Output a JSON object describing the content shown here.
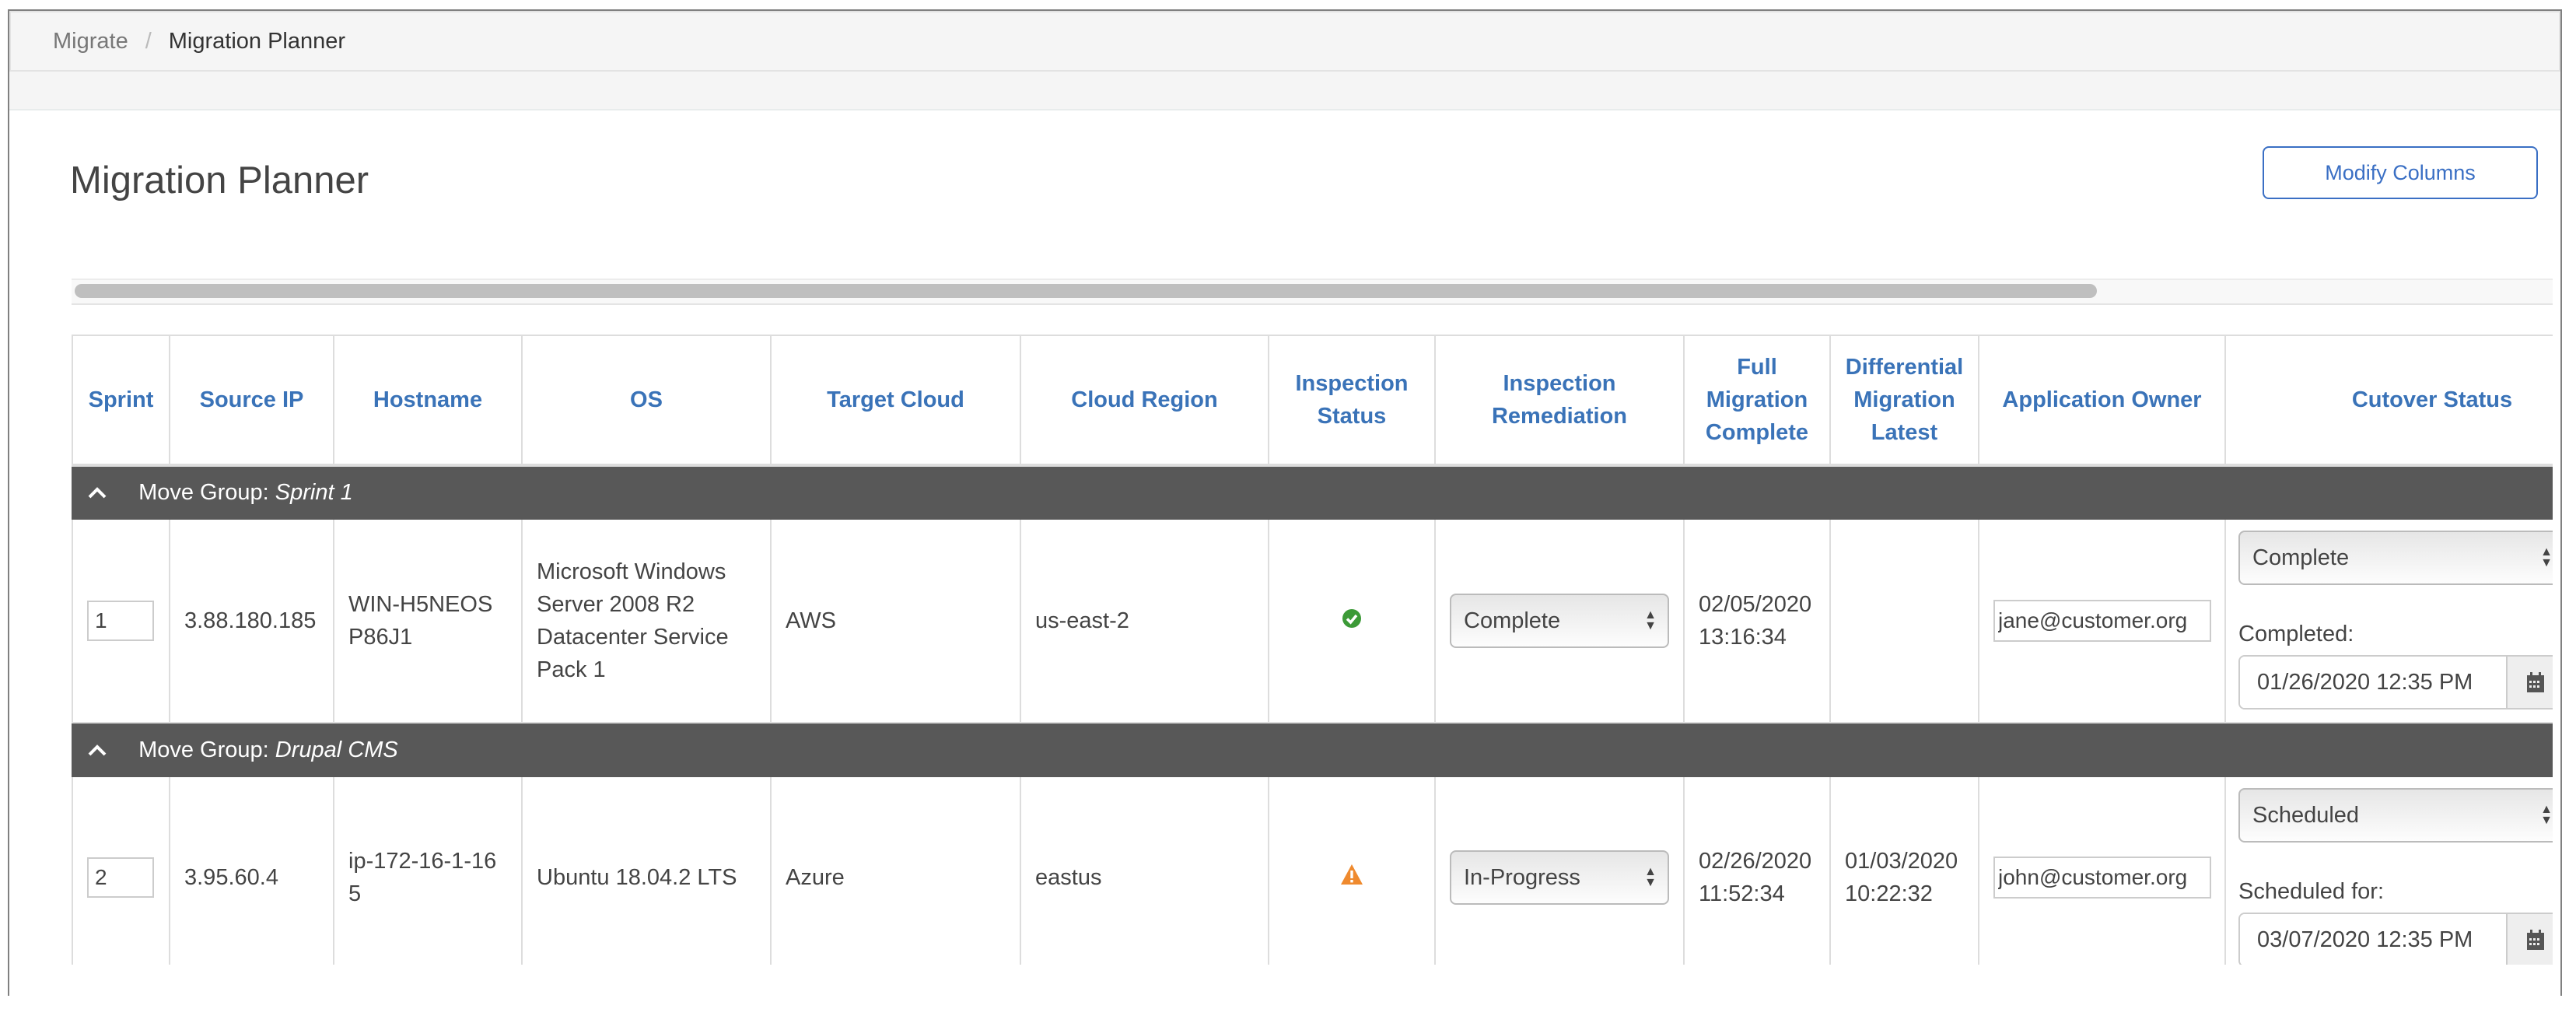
{
  "breadcrumb": {
    "parent": "Migrate",
    "separator": "/",
    "current": "Migration Planner"
  },
  "page": {
    "title": "Migration Planner",
    "modify_columns_label": "Modify Columns"
  },
  "colors": {
    "accent": "#3a73b8",
    "group_row_bg": "#585858",
    "success": "#3c9a37",
    "warning": "#ef8a2e"
  },
  "table": {
    "columns": [
      "Sprint",
      "Source IP",
      "Hostname",
      "OS",
      "Target Cloud",
      "Cloud Region",
      "Inspection Status",
      "Inspection Remediation",
      "Full Migration Complete",
      "Differential Migration Latest",
      "Application Owner",
      "Cutover Status"
    ],
    "groups": [
      {
        "label": "Move Group:",
        "name": "Sprint 1",
        "collapse_icon": "chevron-up-icon",
        "rows": [
          {
            "sprint": "1",
            "source_ip": "3.88.180.185",
            "hostname": "WIN-H5NEOSP86J1",
            "os": "Microsoft Windows Server 2008 R2 Datacenter Service Pack 1",
            "target_cloud": "AWS",
            "cloud_region": "us-east-2",
            "inspection_status": "success",
            "inspection_status_icon": "check-circle-icon",
            "inspection_remediation": "Complete",
            "full_migration_complete": "02/05/2020 13:16:34",
            "differential_migration_latest": "",
            "application_owner": "jane@customer.org",
            "cutover_status": "Complete",
            "cutover_date_label": "Completed:",
            "cutover_date": "01/26/2020 12:35 PM"
          }
        ]
      },
      {
        "label": "Move Group:",
        "name": "Drupal CMS",
        "collapse_icon": "chevron-up-icon",
        "rows": [
          {
            "sprint": "2",
            "source_ip": "3.95.60.4",
            "hostname": "ip-172-16-1-165",
            "os": "Ubuntu 18.04.2 LTS",
            "target_cloud": "Azure",
            "cloud_region": "eastus",
            "inspection_status": "warning",
            "inspection_status_icon": "warning-triangle-icon",
            "inspection_remediation": "In-Progress",
            "full_migration_complete": "02/26/2020 11:52:34",
            "differential_migration_latest": "01/03/2020 10:22:32",
            "application_owner": "john@customer.org",
            "cutover_status": "Scheduled",
            "cutover_date_label": "Scheduled for:",
            "cutover_date": "03/07/2020 12:35 PM"
          }
        ]
      }
    ]
  }
}
